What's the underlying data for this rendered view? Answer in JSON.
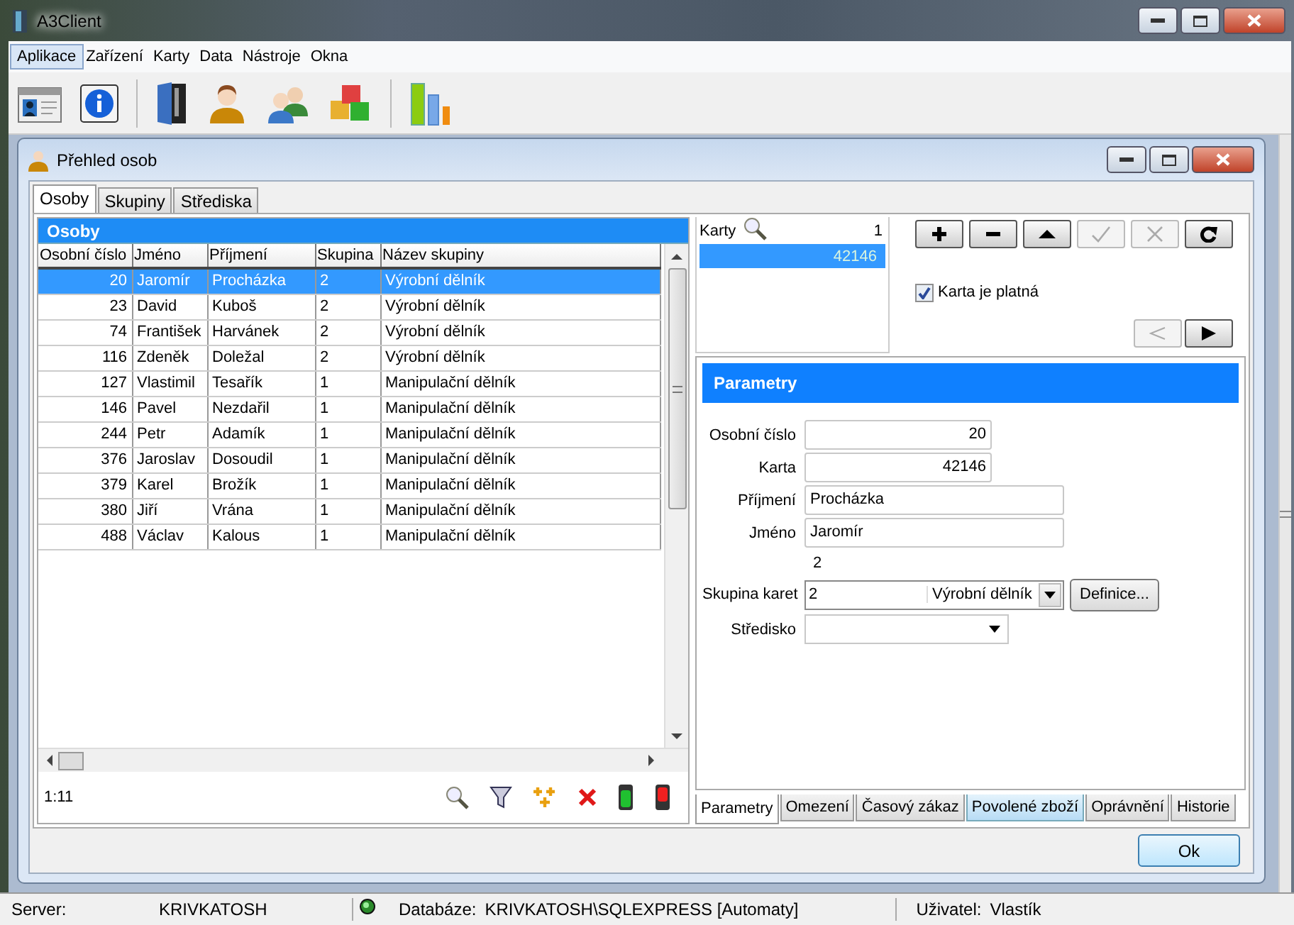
{
  "window": {
    "title": "A3Client"
  },
  "menu": [
    {
      "label": "Aplikace",
      "selected": true
    },
    {
      "label": "Zařízení",
      "selected": false
    },
    {
      "label": "Karty",
      "selected": false
    },
    {
      "label": "Data",
      "selected": false
    },
    {
      "label": "Nástroje",
      "selected": false
    },
    {
      "label": "Okna",
      "selected": false
    }
  ],
  "child_window": {
    "title": "Přehled osob"
  },
  "tabs": [
    {
      "label": "Osoby",
      "selected": true
    },
    {
      "label": "Skupiny",
      "selected": false
    },
    {
      "label": "Střediska",
      "selected": false
    }
  ],
  "people": {
    "title": "Osoby",
    "columns": [
      "Osobní číslo",
      "Jméno",
      "Příjmení",
      "Skupina",
      "Název skupiny"
    ],
    "rows": [
      {
        "cells": [
          "20",
          "Jaromír",
          "Procházka",
          "2",
          "Výrobní dělník"
        ],
        "selected": true
      },
      {
        "cells": [
          "23",
          "David",
          "Kuboš",
          "2",
          "Výrobní dělník"
        ],
        "selected": false
      },
      {
        "cells": [
          "74",
          "František",
          "Harvánek",
          "2",
          "Výrobní dělník"
        ],
        "selected": false
      },
      {
        "cells": [
          "116",
          "Zdeněk",
          "Doležal",
          "2",
          "Výrobní dělník"
        ],
        "selected": false
      },
      {
        "cells": [
          "127",
          "Vlastimil",
          "Tesařík",
          "1",
          "Manipulační dělník"
        ],
        "selected": false
      },
      {
        "cells": [
          "146",
          "Pavel",
          "Nezdařil",
          "1",
          "Manipulační dělník"
        ],
        "selected": false
      },
      {
        "cells": [
          "244",
          "Petr",
          "Adamík",
          "1",
          "Manipulační dělník"
        ],
        "selected": false
      },
      {
        "cells": [
          "376",
          "Jaroslav",
          "Dosoudil",
          "1",
          "Manipulační dělník"
        ],
        "selected": false
      },
      {
        "cells": [
          "379",
          "Karel",
          "Brožík",
          "1",
          "Manipulační dělník"
        ],
        "selected": false
      },
      {
        "cells": [
          "380",
          "Jiří",
          "Vrána",
          "1",
          "Manipulační dělník"
        ],
        "selected": false
      },
      {
        "cells": [
          "488",
          "Václav",
          "Kalous",
          "1",
          "Manipulační dělník"
        ],
        "selected": false
      }
    ],
    "position": "1:11"
  },
  "cards": {
    "label": "Karty",
    "count": "1",
    "items": [
      {
        "value": "42146",
        "selected": true
      }
    ]
  },
  "card_buttons": [
    {
      "kind": "add",
      "disabled": false
    },
    {
      "kind": "remove",
      "disabled": false
    },
    {
      "kind": "up",
      "disabled": false
    },
    {
      "kind": "confirm",
      "disabled": true
    },
    {
      "kind": "cancel",
      "disabled": true
    },
    {
      "kind": "refresh",
      "disabled": false
    }
  ],
  "valid_checkbox": {
    "label": "Karta je platná",
    "checked": true
  },
  "nav_buttons": [
    {
      "kind": "prev",
      "disabled": true
    },
    {
      "kind": "next",
      "disabled": false
    }
  ],
  "params": {
    "title": "Parametry",
    "fields": [
      {
        "label": "Osobní číslo",
        "value": "20",
        "kind": "number"
      },
      {
        "label": "Karta",
        "value": "42146",
        "kind": "number"
      },
      {
        "label": "Příjmení",
        "value": "Procházka",
        "kind": "text"
      },
      {
        "label": "Jméno",
        "value": "Jaromír",
        "kind": "text"
      }
    ],
    "group_number": "2",
    "card_group": {
      "label": "Skupina karet",
      "value": "2",
      "name": "Výrobní dělník",
      "button": "Definice..."
    },
    "centre": {
      "label": "Středisko"
    }
  },
  "bottom_tabs": [
    {
      "label": "Parametry",
      "selected": true,
      "hover": false
    },
    {
      "label": "Omezení",
      "selected": false,
      "hover": false
    },
    {
      "label": "Časový zákaz",
      "selected": false,
      "hover": false
    },
    {
      "label": "Povolené zboží",
      "selected": false,
      "hover": true
    },
    {
      "label": "Oprávnění",
      "selected": false,
      "hover": false
    },
    {
      "label": "Historie",
      "selected": false,
      "hover": false
    }
  ],
  "ok_button": "Ok",
  "status_bar": {
    "server_label": "Server:",
    "server": "KRIVKATOSH",
    "database_label": "Databáze:",
    "database": "KRIVKATOSH\\SQLEXPRESS [Automaty]",
    "user_label": "Uživatel:",
    "user": "Vlastík"
  }
}
